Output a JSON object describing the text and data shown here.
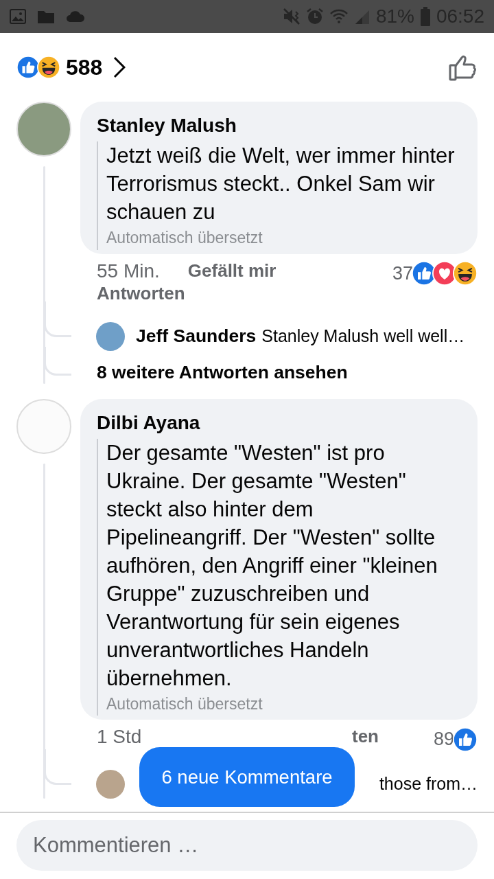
{
  "status_bar": {
    "battery": "81%",
    "time": "06:52"
  },
  "reactions_summary": {
    "reactions": [
      {
        "kind": "like"
      },
      {
        "kind": "haha"
      }
    ],
    "count": "588"
  },
  "comments": [
    {
      "author": "Stanley Malush",
      "text": "Jetzt weiß die Welt, wer immer hinter Terrorismus steckt.. Onkel Sam wir schauen zu",
      "translation_note": "Automatisch übersetzt",
      "time": "55 Min.",
      "actions": [
        {
          "label": "Gefällt mir",
          "partial": false
        },
        {
          "label": "Antworten",
          "partial": false
        }
      ],
      "reaction_count": "37",
      "reactions": [
        {
          "kind": "like"
        },
        {
          "kind": "love"
        },
        {
          "kind": "haha"
        }
      ],
      "replies": [
        {
          "author": "Jeff Saunders",
          "text": "Stanley Malush well well…"
        }
      ],
      "more_replies": "8 weitere Antworten ansehen"
    },
    {
      "author": "Dilbi Ayana",
      "text": "Der gesamte \"Westen\" ist pro Ukraine. Der gesamte \"Westen\" steckt also hinter dem Pipelineangriff. Der \"Westen\" sollte aufhören, den Angriff einer \"kleinen Gruppe\" zuzuschreiben und Verantwortung für sein eigenes unverantwortliches Handeln übernehmen.",
      "translation_note": "Automatisch übersetzt",
      "time": "1 Std",
      "actions": [
        {
          "label": "ten",
          "partial": true
        }
      ],
      "reaction_count": "89",
      "reactions": [
        {
          "kind": "like"
        }
      ],
      "replies": [
        {
          "text": "those from…",
          "partial": true
        }
      ]
    }
  ],
  "new_comments_button": "6 neue Kommentare",
  "comment_field": {
    "placeholder": "Kommentieren …"
  }
}
